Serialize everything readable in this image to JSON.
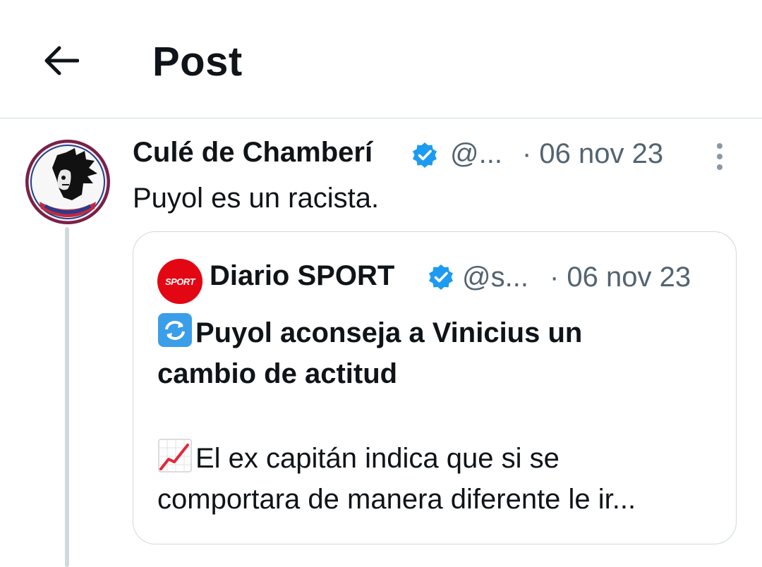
{
  "header": {
    "title": "Post",
    "back_icon": "arrow-left-icon"
  },
  "tweet": {
    "author_name": "Culé de Chamberí",
    "handle": "@...",
    "date": "· 06 nov 23",
    "text": "Puyol es un racista.",
    "verified_color": "#1d9bf0"
  },
  "quote": {
    "avatar_text": "SPORT",
    "author_name": "Diario SPORT",
    "handle": "@s...",
    "date": "· 06 nov 23",
    "headline_line1": "Puyol aconseja a Vinicius un",
    "headline_line2": "cambio de actitud",
    "body_line1": "El ex capitán indica que si se",
    "body_line2": "comportara de manera diferente le ir...",
    "headline_emoji": "repeat-arrows-emoji",
    "body_emoji": "chart-increasing-emoji"
  },
  "colors": {
    "text": "#0f1419",
    "secondary": "#536471",
    "border": "#cfd9de",
    "sport_red": "#e30613"
  }
}
